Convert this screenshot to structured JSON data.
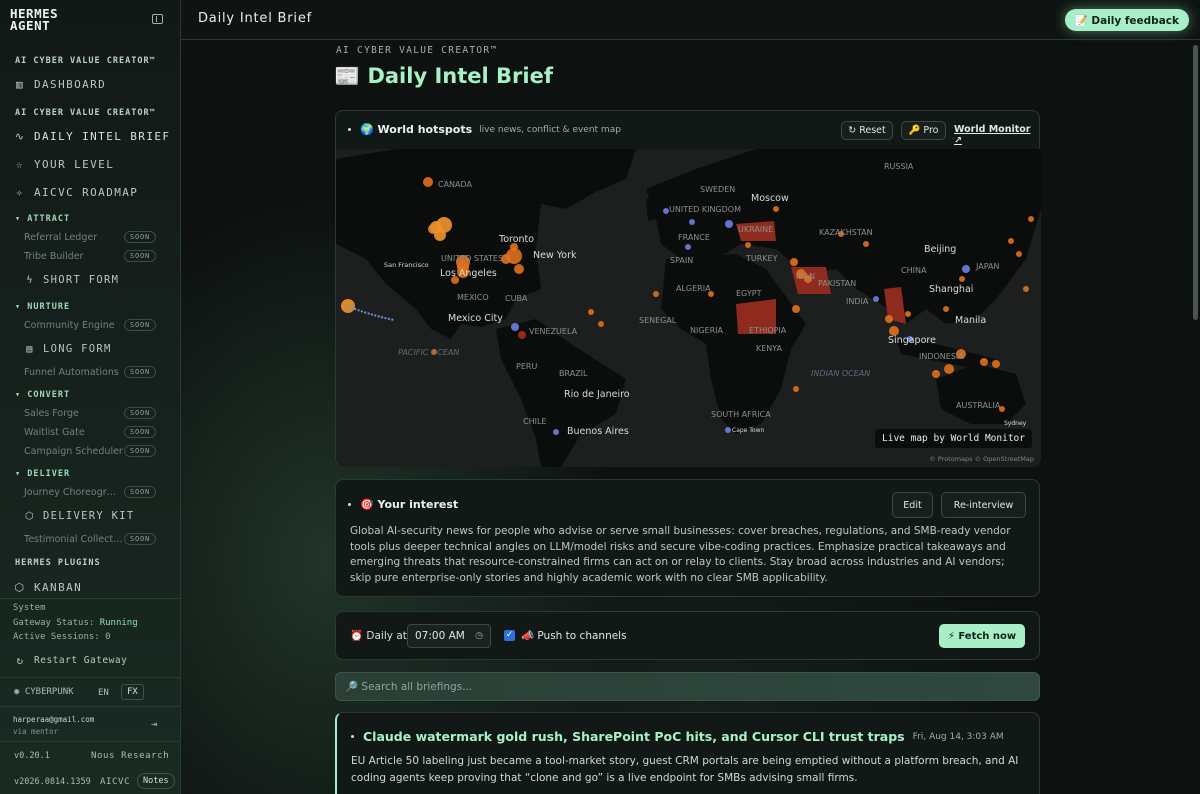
{
  "sidebar": {
    "brand_line1": "HERMES",
    "brand_line2": "AGENT",
    "section1": "AI CYBER VALUE CREATOR™",
    "dashboard": "DASHBOARD",
    "section2": "AI CYBER VALUE CREATOR™",
    "daily_intel_brief": "DAILY INTEL BRIEF",
    "your_level": "YOUR LEVEL",
    "roadmap": "AICVC ROADMAP",
    "group_attract": "▾ ATTRACT",
    "referral_ledger": "Referral Ledger",
    "tribe_builder": "Tribe Builder",
    "short_form": "SHORT FORM",
    "group_nurture": "▾ NURTURE",
    "community_engine": "Community Engine",
    "long_form": "LONG FORM",
    "funnel_automations": "Funnel Automations",
    "group_convert": "▾ CONVERT",
    "sales_forge": "Sales Forge",
    "waitlist_gate": "Waitlist Gate",
    "campaign_scheduler": "Campaign Scheduler",
    "group_deliver": "▾ DELIVER",
    "journey_choreographer": "Journey Choreogr…",
    "delivery_kit": "DELIVERY KIT",
    "testimonial_collector": "Testimonial Collect…",
    "soon": "SOON",
    "plugins_section": "HERMES PLUGINS",
    "kanban": "KANBAN",
    "system_label": "System",
    "gateway_status_label": "Gateway Status:",
    "gateway_status_value": "Running",
    "active_sessions": "Active Sessions: 0",
    "restart_gateway": "Restart Gateway",
    "theme": "CYBERPUNK",
    "lang_en": "EN",
    "lang_fx": "FX",
    "email": "harperaa@gmail.com",
    "via": "via mentor",
    "version": "v0.20.1",
    "vendor": "Nous Research",
    "build": "v2026.0814.1359",
    "product": "AICVC",
    "notes": "Notes"
  },
  "topbar": {
    "title": "Daily Intel Brief",
    "feedback": "📝 Daily feedback"
  },
  "main": {
    "eyebrow": "AI CYBER VALUE CREATOR™",
    "heading": "📰 Daily Intel Brief",
    "hotspots": {
      "title": "🌍 World hotspots",
      "subtitle": "live news, conflict & event map",
      "reset": "↻ Reset",
      "pro": "🔑 Pro",
      "world_monitor": "World Monitor ↗",
      "map_badge": "Live map by World Monitor",
      "attribution": "© Protomaps © OpenStreetMap",
      "labels": {
        "russia": "RUSSIA",
        "canada": "CANADA",
        "sweden": "SWEDEN",
        "moscow": "Moscow",
        "uk": "UNITED KINGDOM",
        "france": "FRANCE",
        "ukraine": "UKRAINE",
        "kazakhstan": "KAZAKHSTAN",
        "spain": "SPAIN",
        "turkey": "TURKEY",
        "iran": "IRAN",
        "pakistan": "PAKISTAN",
        "beijing": "Beijing",
        "china": "CHINA",
        "japan": "JAPAN",
        "shanghai": "Shanghai",
        "toronto": "Toronto",
        "newyork": "New York",
        "us": "UNITED STATES",
        "sf": "San Francisco",
        "la": "Los Angeles",
        "mexico": "MEXICO",
        "cuba": "CUBA",
        "mexicocity": "Mexico City",
        "algeria": "ALGERIA",
        "egypt": "EGYPT",
        "india": "INDIA",
        "manila": "Manila",
        "venezuela": "VENEZUELA",
        "senegal": "SENEGAL",
        "nigeria": "NIGERIA",
        "ethiopia": "ETHIOPIA",
        "kenya": "KENYA",
        "singapore": "Singapore",
        "indonesia": "INDONESIA",
        "pacific": "PACIFIC OCEAN",
        "peru": "PERU",
        "brazil": "BRAZIL",
        "rio": "Rio de Janeiro",
        "indianocean": "INDIAN OCEAN",
        "australia": "AUSTRALIA",
        "chile": "CHILE",
        "southafrica": "SOUTH AFRICA",
        "capetown": "Cape Town",
        "buenosaires": "Buenos Aires",
        "sydney": "Sydney"
      }
    },
    "interest": {
      "title": "🎯 Your interest",
      "edit": "Edit",
      "reinterview": "Re-interview",
      "text": "Global AI-security news for people who advise or serve small businesses: cover breaches, regulations, and SMB-ready vendor tools plus deeper technical angles on LLM/model risks and secure vibe-coding practices. Emphasize practical takeaways and emerging threats that resource-constrained firms can act on or relay to clients. Stay broad across industries and AI vendors; skip pure enterprise-only stories and highly academic work with no clear SMB applicability."
    },
    "schedule": {
      "daily_at": "⏰ Daily at",
      "time": "07:00 AM",
      "push_checked": true,
      "push_label": "📣 Push to channels",
      "fetch": "⚡ Fetch now"
    },
    "search_placeholder": "🔎 Search all briefings...",
    "brief": {
      "title": "Claude watermark gold rush, SharePoint PoC hits, and Cursor CLI trust traps",
      "date": "Fri, Aug 14, 3:03 AM",
      "summary": "EU Article 50 labeling just became a tool-market story, guest CRM portals are being emptied without a platform breach, and AI coding agents keep proving that “clone and go” is a live endpoint for SMBs advising small firms."
    }
  },
  "colors": {
    "accent": "#a8efc8",
    "heading": "#a6f2c6",
    "hotspot_orange": "#e0701e",
    "hotspot_red": "#a82a1c",
    "hotspot_blue": "#6e7fe0"
  }
}
